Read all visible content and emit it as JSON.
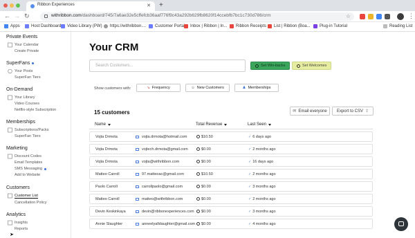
{
  "browser": {
    "tab_title": "Ribbon Experiences",
    "url_host": "withribbon.com",
    "url_path": "/dashboard/745/7a6ae32e5cffefcb36aaf776f9c43a292b629fb8620f14ccebfb7bc1c730d786/crm",
    "bookmarks": [
      "Apps",
      "Host Dashboard",
      "Video Library (PW)",
      "https://withribbon....",
      "Customer Portal",
      "Inbox | Ribbon | In...",
      "Ribbon Receipts",
      "List | Ribbon (Boa...",
      "Plug-in Tutorial",
      "Reading List"
    ]
  },
  "sidebar": {
    "sections": [
      {
        "title": "Private Events",
        "items": [
          "Your Calendar",
          "Create Private"
        ]
      },
      {
        "title": "SuperFans",
        "items": [
          "Your Posts",
          "SuperFan Tiers"
        ]
      },
      {
        "title": "On-Demand",
        "items": [
          "Your Library",
          "Video Courses",
          "Netflix-style Subscription"
        ]
      },
      {
        "title": "Memberships",
        "items": [
          "Subscriptions/Packs",
          "SuperFan Tiers"
        ]
      },
      {
        "title": "Marketing",
        "items": [
          "Discount Codes",
          "Email Templates",
          "SMS Messaging",
          "Add to Website"
        ]
      },
      {
        "title": "Customers",
        "items": [
          "Customer List",
          "Cancellation Policy"
        ]
      },
      {
        "title": "Analytics",
        "items": [
          "Insights",
          "Reports"
        ]
      }
    ]
  },
  "main": {
    "title": "Your CRM",
    "search_placeholder": "Search Customers...",
    "set_winbacks": "Set Win-backs",
    "set_welcomes": "Set Welcomes",
    "show_label": "Show customers with:",
    "filters": [
      "Frequency",
      "New Customers",
      "Memberships"
    ],
    "count_label": "15 customers",
    "email_everyone": "Email everyone",
    "export_csv": "Export to CSV",
    "columns": [
      "Name",
      "Total Revenue",
      "Last Seen"
    ],
    "rows": [
      {
        "name": "Vojta Drmota",
        "email": "vojta.drmota@hotmail.com",
        "revenue": "$10.50",
        "seen": "6 days ago"
      },
      {
        "name": "Vojta Drmota",
        "email": "vojtech.drmota@gmail.com",
        "revenue": "$0.00",
        "seen": "2 months ago"
      },
      {
        "name": "Vojta Drmota",
        "email": "vojta@withribbon.com",
        "revenue": "$0.00",
        "seen": "16 days ago"
      },
      {
        "name": "Matteo Carroll",
        "email": "97.matteoac@gmail.com",
        "revenue": "$10.50",
        "seen": "2 months ago"
      },
      {
        "name": "Paolo Carroll",
        "email": "carrollpaolo@gmail.com",
        "revenue": "$0.00",
        "seen": "3 months ago"
      },
      {
        "name": "Matteo Carroll",
        "email": "matteo@withribbon.com",
        "revenue": "$0.00",
        "seen": "2 months ago"
      },
      {
        "name": "Devin Keskinkaya",
        "email": "devin@ribbonexperiences.com",
        "revenue": "$0.00",
        "seen": "3 months ago"
      },
      {
        "name": "Annie Slaughter",
        "email": "anneelyalldaughter@gmail.com",
        "revenue": "$0.00",
        "seen": "4 months ago"
      }
    ]
  },
  "colors": {
    "winbacks_bg": "#3aa55b",
    "welcomes_bg": "#e6eda0",
    "accent_blue": "#3b6fd8"
  }
}
